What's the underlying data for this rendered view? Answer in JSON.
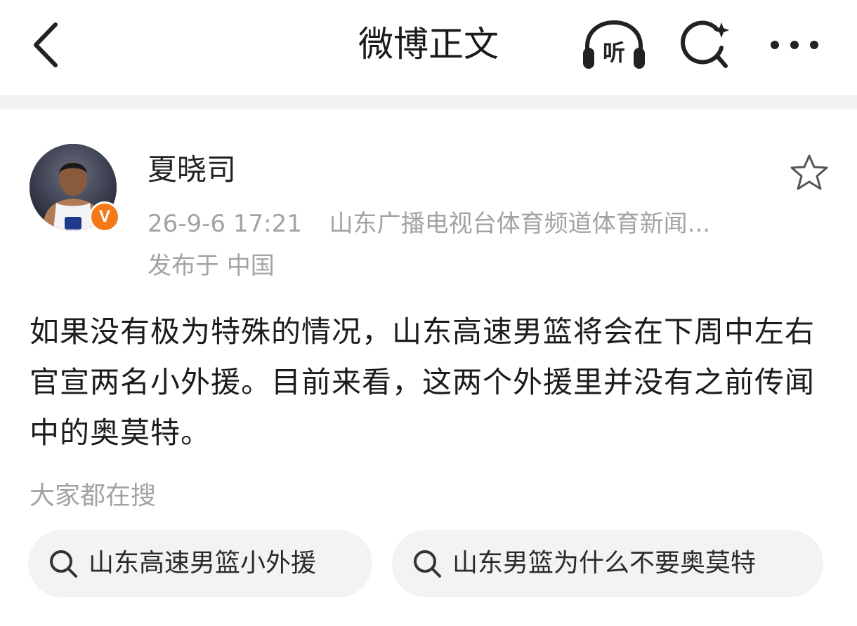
{
  "header": {
    "title": "微博正文",
    "listen_label": "听",
    "icons": [
      "back-arrow-icon",
      "headphones-icon",
      "search-icon",
      "more-icon"
    ]
  },
  "post": {
    "username": "夏晓司",
    "verified_label": "V",
    "time": "26-9-6 17:21",
    "source": "山东广播电视台体育频道体育新闻...",
    "location": "发布于 中国",
    "text": "如果没有极为特殊的情况，山东高速男篮将会在下周中左右官宣两名小外援。目前来看，这两个外援里并没有之前传闻中的奥莫特。"
  },
  "trending": {
    "label": "大家都在搜",
    "chips": [
      {
        "label": "山东高速男篮小外援"
      },
      {
        "label": "山东男篮为什么不要奥莫特"
      }
    ]
  },
  "colors": {
    "accent_orange": "#f57a17",
    "text_primary": "#1c1c1c",
    "text_secondary": "#a3a3a3",
    "chip_background": "#f3f3f3"
  }
}
